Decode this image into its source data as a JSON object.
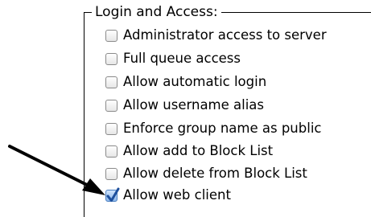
{
  "group": {
    "title": "Login and Access:"
  },
  "options": [
    {
      "label": "Administrator access to server",
      "checked": false
    },
    {
      "label": "Full queue access",
      "checked": false
    },
    {
      "label": "Allow automatic login",
      "checked": false
    },
    {
      "label": "Allow username alias",
      "checked": false
    },
    {
      "label": "Enforce group name as public",
      "checked": false
    },
    {
      "label": "Allow add to Block List",
      "checked": false
    },
    {
      "label": "Allow delete from Block List",
      "checked": false
    },
    {
      "label": "Allow web client",
      "checked": true
    }
  ],
  "icons": {
    "checkmark": "checkmark-icon",
    "annotation": "arrow-icon"
  },
  "colors": {
    "check": "#1d4f9c",
    "checked_box": "#8fb8ea"
  }
}
